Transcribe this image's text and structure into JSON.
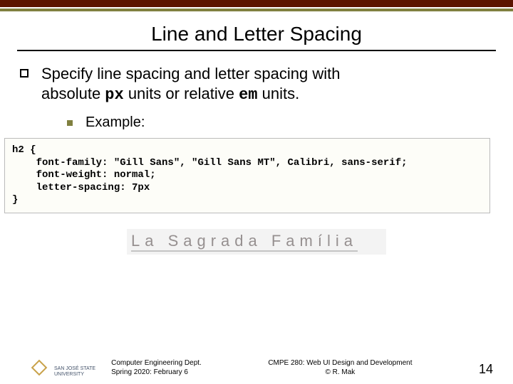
{
  "title": "Line and Letter Spacing",
  "bullet": {
    "line1": "Specify line spacing and letter spacing with",
    "line2_pre": "absolute ",
    "px": "px",
    "line2_mid": " units or relative ",
    "em": "em",
    "line2_post": " units."
  },
  "example_label": "Example:",
  "code": "h2 {\n    font-family: \"Gill Sans\", \"Gill Sans MT\", Calibri, sans-serif;\n    font-weight: normal;\n    letter-spacing: 7px\n}",
  "rendered_heading": "La Sagrada Família",
  "footer": {
    "uni_l1": "SAN JOSÉ STATE",
    "uni_l2": "UNIVERSITY",
    "left_l1": "Computer Engineering Dept.",
    "left_l2": "Spring 2020: February 6",
    "center_l1": "CMPE 280: Web UI Design and Development",
    "center_l2": "© R. Mak",
    "page": "14"
  }
}
